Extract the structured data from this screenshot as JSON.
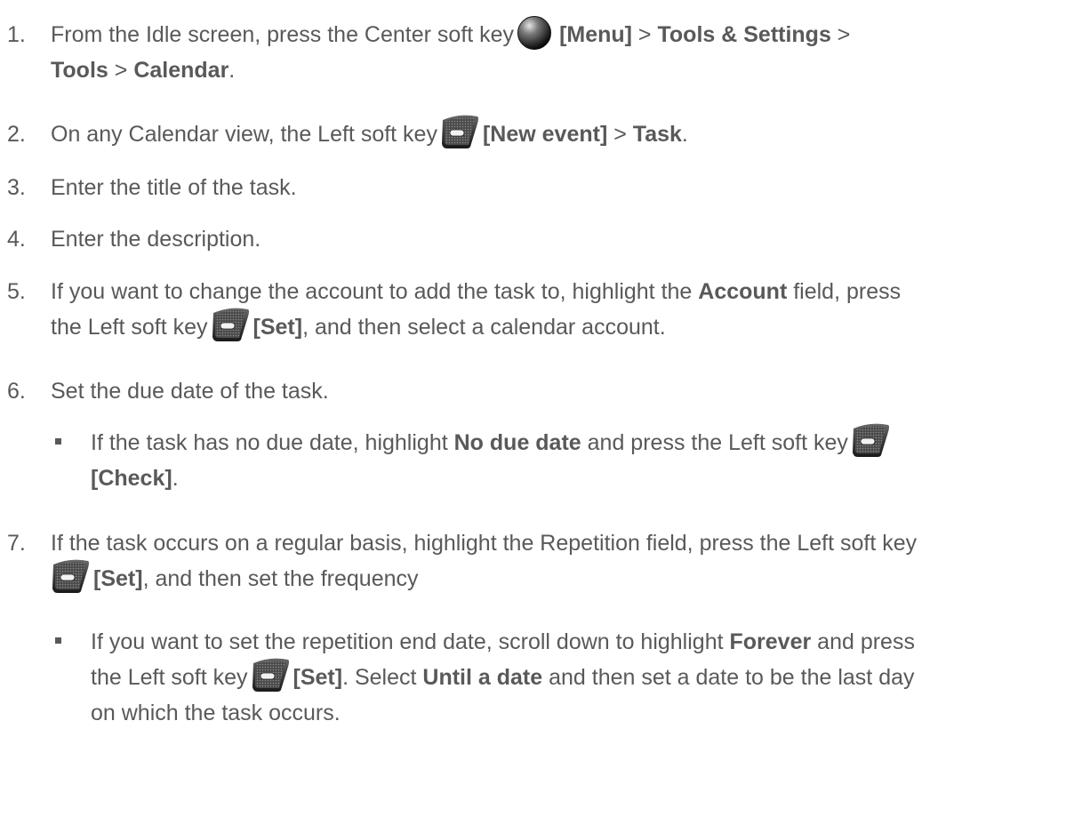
{
  "steps": [
    {
      "number": "1.",
      "parts": [
        "From the Idle screen, press the Center soft key",
        "[Menu]",
        " > ",
        "Tools & Settings",
        " >",
        "Tools",
        " > ",
        "Calendar",
        "."
      ]
    },
    {
      "number": "2.",
      "parts": [
        "On any Calendar view, the Left soft key",
        "[New event]",
        " > ",
        "Task",
        "."
      ]
    },
    {
      "number": "3.",
      "text": "Enter the title of the task."
    },
    {
      "number": "4.",
      "text": "Enter the description."
    },
    {
      "number": "5.",
      "parts": [
        "If you want to change the account to add the task to, highlight the ",
        "Account",
        " field, press",
        "the Left soft key",
        "[Set]",
        ", and then select a calendar account."
      ]
    },
    {
      "number": "6.",
      "text": "Set the due date of the task."
    },
    {
      "number": "7.",
      "parts": [
        "If the task occurs on a regular basis, highlight the Repetition field, press the Left soft key",
        "[Set]",
        ", and then set the frequency"
      ]
    }
  ],
  "bullets": [
    {
      "parts": [
        "If the task has no due date, highlight ",
        "No due date",
        " and press the Left soft key",
        "[Check]",
        "."
      ]
    },
    {
      "parts": [
        "If you want to set the repetition end date, scroll down to highlight ",
        "Forever",
        " and press",
        "the Left soft key",
        "[Set]",
        ". Select ",
        "Until a date",
        " and then set a date to be the last day",
        "on which the task occurs."
      ]
    }
  ],
  "icons": {
    "center_key": "center-soft-key-icon",
    "left_key": "left-soft-key-icon"
  }
}
